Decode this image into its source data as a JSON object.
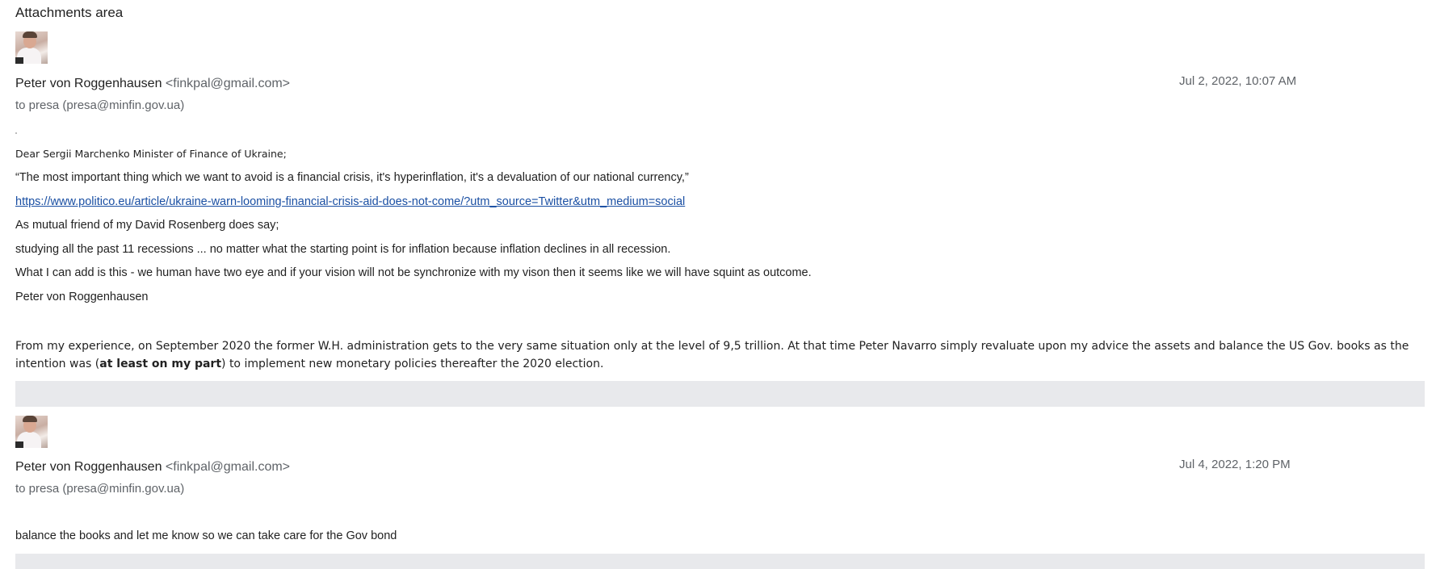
{
  "attachments_area": {
    "title": "Attachments area"
  },
  "messages": [
    {
      "sender_name": "Peter von Roggenhausen",
      "sender_email": "<finkpal@gmail.com>",
      "recipient": "to presa (presa@minfin.gov.ua)",
      "date": "Jul 2, 2022, 10:07 AM",
      "body": {
        "salutation": "Dear Sergii Marchenko Minister of Finance of Ukraine;",
        "quote": "“The most important thing which we want to avoid is a financial crisis, it's hyperinflation, it's a devaluation of our national currency,”",
        "link": "https://www.politico.eu/article/ukraine-warn-looming-financial-crisis-aid-does-not-come/?utm_source=Twitter&utm_medium=social",
        "line_friend": "As mutual friend of my David Rosenberg does say;",
        "line_recessions": "studying all the past 11 recessions ... no matter what the starting point is for inflation because inflation declines in all recession.",
        "line_vision": "What I can add is this - we human have two eye and if your vision will not be synchronize with my vison then it seems like we will have squint as outcome.",
        "signature": "Peter von Roggenhausen",
        "experience_start": "From my experience, on September 2020 the former W.H. administration gets to the very same situation only at the level of 9,5 trillion. At that time Peter Navarro simply revaluate upon my advice the assets and balance the US Gov. books as the intention was (",
        "experience_bold": "at least on my part",
        "experience_end": ") to implement new monetary policies thereafter the 2020 election."
      }
    },
    {
      "sender_name": "Peter von Roggenhausen",
      "sender_email": "<finkpal@gmail.com>",
      "recipient": "to presa (presa@minfin.gov.ua)",
      "date": "Jul 4, 2022, 1:20 PM",
      "body": {
        "text": "balance the books and let me know so we can take care for the Gov bond"
      }
    }
  ]
}
